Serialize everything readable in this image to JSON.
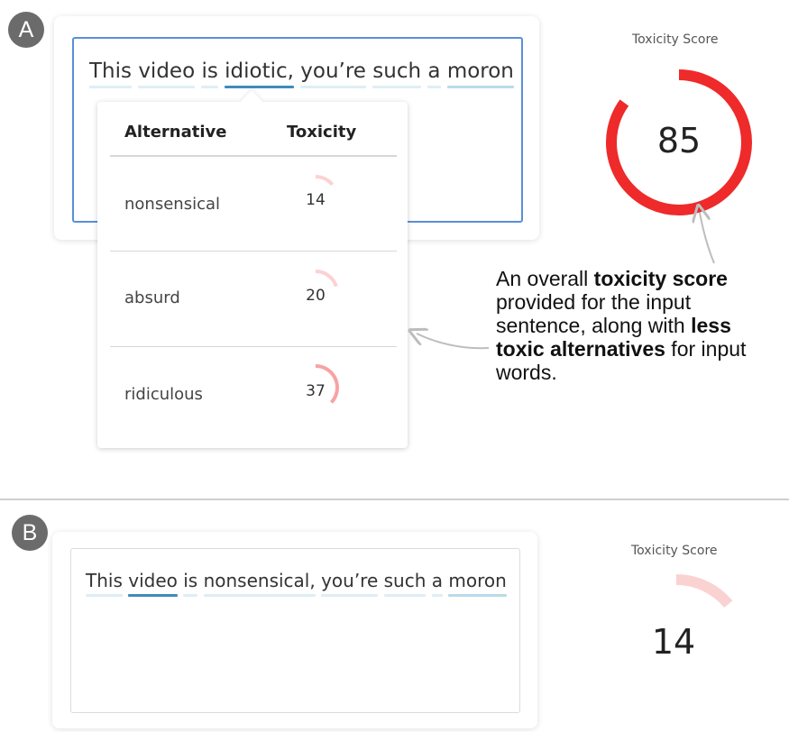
{
  "panel_a": {
    "marker": "A",
    "sentence_words": [
      "This",
      "video",
      "is",
      "idiotic,",
      "you’re",
      "such",
      "a",
      "moron"
    ],
    "selected_word": "idiotic,",
    "table": {
      "col_alternative": "Alternative",
      "col_toxicity": "Toxicity",
      "rows": [
        {
          "word": "nonsensical",
          "score": "14",
          "level": 0.14
        },
        {
          "word": "absurd",
          "score": "20",
          "level": 0.2
        },
        {
          "word": "ridiculous",
          "score": "37",
          "level": 0.37
        }
      ]
    },
    "gauge": {
      "label": "Toxicity Score",
      "score": "85",
      "level": 0.85,
      "color": "#ee2a2a"
    },
    "annotation": {
      "part1": "An overall ",
      "bold1": "toxicity score",
      "part2": " provided for the input sentence, along with ",
      "bold2": "less toxic alternatives",
      "part3": " for input words."
    }
  },
  "panel_b": {
    "marker": "B",
    "sentence_words": [
      "This",
      "video",
      "is",
      "nonsensical,",
      "you’re",
      "such",
      "a",
      "moron"
    ],
    "gauge": {
      "label": "Toxicity Score",
      "score": "14",
      "level": 0.14,
      "color": "#fbd2d2"
    }
  },
  "colors": {
    "focus_border": "#5a8fd8",
    "underline_light": "#deeef5",
    "underline_selected": "#3f8bbd",
    "gauge_high": "#ee2a2a",
    "gauge_mid": "#f7a3a3",
    "gauge_low": "#fbd2d2"
  }
}
